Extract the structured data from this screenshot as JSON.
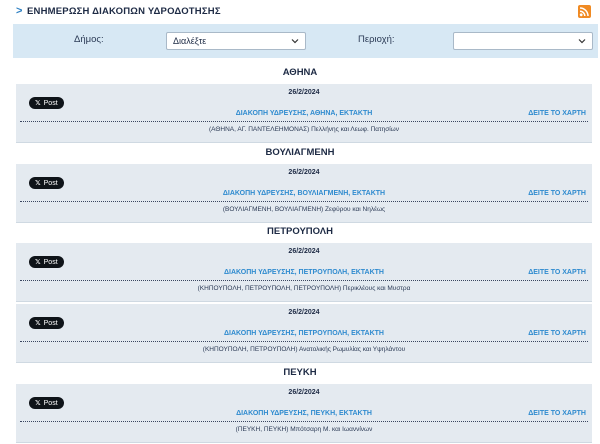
{
  "header": {
    "title": "ΕΝΗΜΕΡΩΣΗ ΔΙΑΚΟΠΩΝ ΥΔΡΟΔΟΤΗΣΗΣ",
    "rss_icon": "rss-icon"
  },
  "filter": {
    "municipality_label": "Δήμος:",
    "municipality_value": "Διαλέξτε",
    "area_label": "Περιοχή:",
    "area_value": ""
  },
  "common": {
    "x_post_label": "Post",
    "map_link": "ΔΕΙΤΕ ΤΟ ΧΑΡΤΗ"
  },
  "groups": [
    {
      "area": "ΑΘΗΝΑ",
      "notices": [
        {
          "date": "26/2/2024",
          "headline": "ΔΙΑΚΟΠΗ ΥΔΡΕΥΣΗΣ, ΑΘΗΝΑ, ΕΚΤΑΚΤΗ",
          "streets": "(ΑΘΗΝΑ, ΑΓ. ΠΑΝΤΕΛΕΗΜΟΝΑΣ) Πελλήνης και Λεωφ. Πατησίων"
        }
      ]
    },
    {
      "area": "ΒΟΥΛΙΑΓΜΕΝΗ",
      "notices": [
        {
          "date": "26/2/2024",
          "headline": "ΔΙΑΚΟΠΗ ΥΔΡΕΥΣΗΣ, ΒΟΥΛΙΑΓΜΕΝΗ, ΕΚΤΑΚΤΗ",
          "streets": "(ΒΟΥΛΙΑΓΜΕΝΗ, ΒΟΥΛΙΑΓΜΕΝΗ) Ζεφύρου και Νηλέως"
        }
      ]
    },
    {
      "area": "ΠΕΤΡΟΥΠΟΛΗ",
      "notices": [
        {
          "date": "26/2/2024",
          "headline": "ΔΙΑΚΟΠΗ ΥΔΡΕΥΣΗΣ, ΠΕΤΡΟΥΠΟΛΗ, ΕΚΤΑΚΤΗ",
          "streets": "(ΚΗΠΟΥΠΟΛΗ, ΠΕΤΡΟΥΠΟΛΗ, ΠΕΤΡΟΥΠΟΛΗ) Περικλέους και Μυστρα"
        },
        {
          "date": "26/2/2024",
          "headline": "ΔΙΑΚΟΠΗ ΥΔΡΕΥΣΗΣ, ΠΕΤΡΟΥΠΟΛΗ, ΕΚΤΑΚΤΗ",
          "streets": "(ΚΗΠΟΥΠΟΛΗ, ΠΕΤΡΟΥΠΟΛΗ) Ανατολικής Ρωμυλίας και Υψηλάντου"
        }
      ]
    },
    {
      "area": "ΠΕΥΚΗ",
      "notices": [
        {
          "date": "26/2/2024",
          "headline": "ΔΙΑΚΟΠΗ ΥΔΡΕΥΣΗΣ, ΠΕΥΚΗ, ΕΚΤΑΚΤΗ",
          "streets": "(ΠΕΥΚΗ, ΠΕΥΚΗ) Μπότσαρη Μ. και Ιωαννίνων"
        }
      ]
    }
  ]
}
